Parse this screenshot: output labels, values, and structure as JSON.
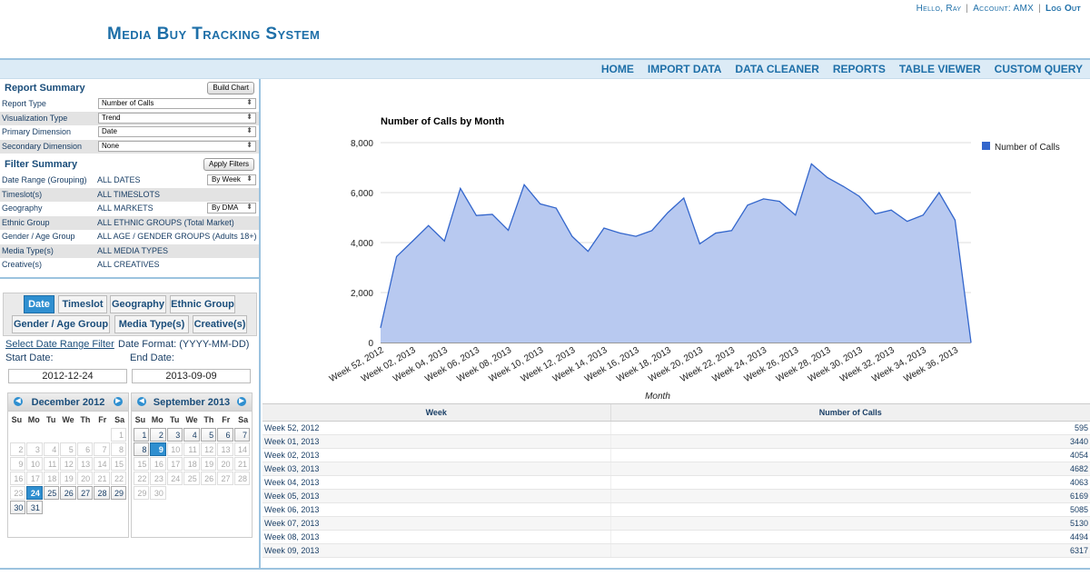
{
  "header": {
    "user_greeting": "Hello, Ray",
    "account": "Account: AMX",
    "logout": "Log Out",
    "app_title": "Media Buy Tracking System"
  },
  "nav": [
    "HOME",
    "IMPORT DATA",
    "DATA CLEANER",
    "REPORTS",
    "TABLE VIEWER",
    "CUSTOM QUERY"
  ],
  "report_summary": {
    "title": "Report Summary",
    "build_button": "Build Chart",
    "rows": [
      {
        "label": "Report Type",
        "value": "Number of Calls"
      },
      {
        "label": "Visualization Type",
        "value": "Trend"
      },
      {
        "label": "Primary Dimension",
        "value": "Date"
      },
      {
        "label": "Secondary Dimension",
        "value": "None"
      }
    ]
  },
  "filter_summary": {
    "title": "Filter Summary",
    "apply_button": "Apply Filters",
    "rows": [
      {
        "label": "Date Range (Grouping)",
        "value": "ALL DATES",
        "select": "By Week"
      },
      {
        "label": "Timeslot(s)",
        "value": "ALL TIMESLOTS"
      },
      {
        "label": "Geography",
        "value": "ALL MARKETS",
        "select": "By DMA"
      },
      {
        "label": "Ethnic Group",
        "value": "ALL ETHNIC GROUPS (Total Market)"
      },
      {
        "label": "Gender / Age Group",
        "value": "ALL AGE / GENDER GROUPS (Adults 18+)"
      },
      {
        "label": "Media Type(s)",
        "value": "ALL MEDIA TYPES"
      },
      {
        "label": "Creative(s)",
        "value": "ALL CREATIVES"
      }
    ]
  },
  "filter_tabs": [
    "Date",
    "Timeslot",
    "Geography",
    "Ethnic Group",
    "Gender / Age Group",
    "Media Type(s)",
    "Creative(s)"
  ],
  "date_filter": {
    "select_link": "Select Date Range Filter",
    "format_label": "Date Format: (YYYY-MM-DD)",
    "start_label": "Start Date:",
    "end_label": "End Date:",
    "start_value": "2012-12-24",
    "end_value": "2013-09-09"
  },
  "calendars": [
    {
      "month": "December 2012",
      "days_of_week": [
        "Su",
        "Mo",
        "Tu",
        "We",
        "Th",
        "Fr",
        "Sa"
      ],
      "first_weekday": 6,
      "days": 31,
      "selected": 24,
      "active_from": 24,
      "active_to": 31
    },
    {
      "month": "September 2013",
      "days_of_week": [
        "Su",
        "Mo",
        "Tu",
        "We",
        "Th",
        "Fr",
        "Sa"
      ],
      "first_weekday": 0,
      "days": 30,
      "selected": 9,
      "active_from": 1,
      "active_to": 9
    }
  ],
  "colors": {
    "series": "#3366cc",
    "area": "#b8c9f0",
    "accent": "#1e6fa8"
  },
  "chart_data": {
    "type": "area",
    "title": "Number of Calls by Month",
    "xlabel": "Month",
    "ylabel": "",
    "ylim": [
      0,
      8000
    ],
    "yticks": [
      "0",
      "2,000",
      "4,000",
      "6,000",
      "8,000"
    ],
    "x_tick_labels": [
      "Week 52, 2012",
      "Week 02, 2013",
      "Week 04, 2013",
      "Week 06, 2013",
      "Week 08, 2013",
      "Week 10, 2013",
      "Week 12, 2013",
      "Week 14, 2013",
      "Week 16, 2013",
      "Week 18, 2013",
      "Week 20, 2013",
      "Week 22, 2013",
      "Week 24, 2013",
      "Week 26, 2013",
      "Week 28, 2013",
      "Week 30, 2013",
      "Week 32, 2013",
      "Week 34, 2013",
      "Week 36, 2013"
    ],
    "legend_position": "right",
    "series": [
      {
        "name": "Number of Calls",
        "values": [
          595,
          3440,
          4054,
          4682,
          4063,
          6169,
          5085,
          5130,
          4494,
          6317,
          5550,
          5380,
          4250,
          3650,
          4580,
          4380,
          4250,
          4480,
          5200,
          5780,
          3950,
          4380,
          4480,
          5500,
          5750,
          5650,
          5100,
          7150,
          6600,
          6250,
          5850,
          5150,
          5300,
          4850,
          5100,
          6000,
          4900,
          0
        ]
      }
    ]
  },
  "table": {
    "headers": [
      "Week",
      "Number of Calls"
    ],
    "rows": [
      [
        "Week 52, 2012",
        "595"
      ],
      [
        "Week 01, 2013",
        "3440"
      ],
      [
        "Week 02, 2013",
        "4054"
      ],
      [
        "Week 03, 2013",
        "4682"
      ],
      [
        "Week 04, 2013",
        "4063"
      ],
      [
        "Week 05, 2013",
        "6169"
      ],
      [
        "Week 06, 2013",
        "5085"
      ],
      [
        "Week 07, 2013",
        "5130"
      ],
      [
        "Week 08, 2013",
        "4494"
      ],
      [
        "Week 09, 2013",
        "6317"
      ]
    ]
  }
}
